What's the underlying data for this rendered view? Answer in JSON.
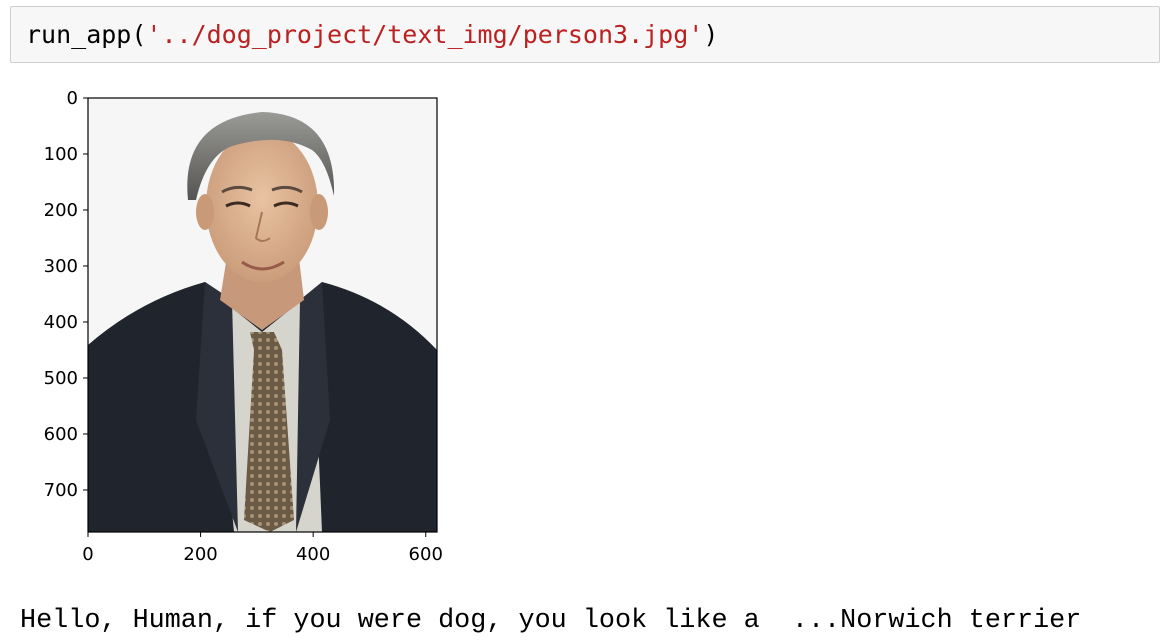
{
  "cell": {
    "code_fn": "run_app(",
    "code_arg": "'../dog_project/text_img/person3.jpg'",
    "code_close": ")"
  },
  "figure": {
    "description_icon": "photo-of-person-icon",
    "x_ticks": [
      "0",
      "200",
      "400",
      "600"
    ],
    "y_ticks": [
      "0",
      "100",
      "200",
      "300",
      "400",
      "500",
      "600",
      "700"
    ],
    "x_range": [
      0,
      620
    ],
    "y_range": [
      0,
      775
    ]
  },
  "output": {
    "text": "Hello, Human, if you were dog, you look like a  ...Norwich terrier"
  },
  "colors": {
    "string": "#ba2121",
    "cell_bg": "#f7f7f7",
    "cell_border": "#cfcfcf"
  }
}
